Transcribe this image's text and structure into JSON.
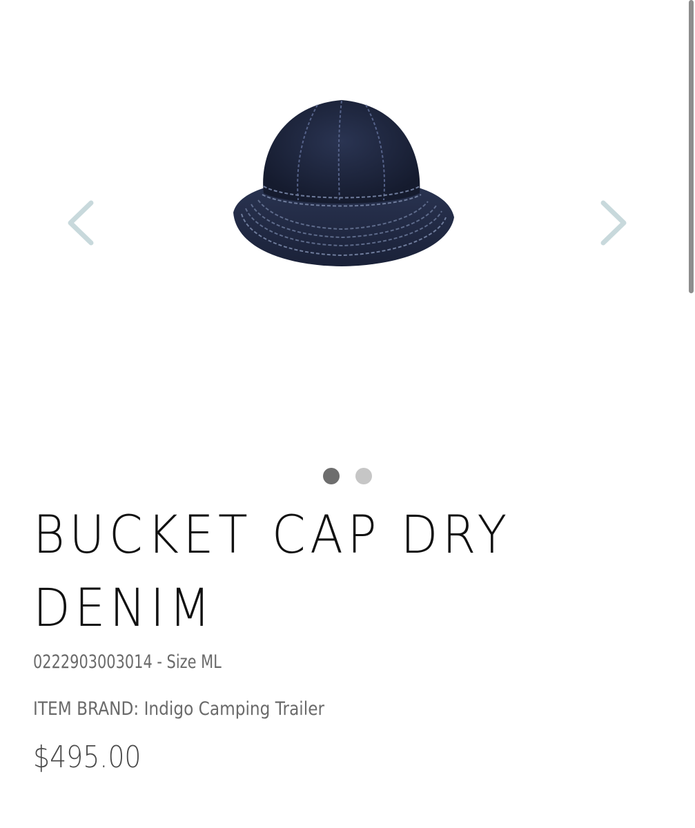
{
  "gallery": {
    "prev_icon": "chevron-left-icon",
    "next_icon": "chevron-right-icon",
    "arrow_color": "#c8d9dc",
    "image_subject": "denim bucket hat",
    "slides_total": 2,
    "active_slide": 1
  },
  "product": {
    "title_line1": "BUCKET CAP DRY",
    "title_line2": "DENIM",
    "sku_line": "0222903003014 - Size ML",
    "brand_line": "ITEM BRAND: Indigo Camping Trailer",
    "price": "$495.00"
  },
  "colors": {
    "title": "#111111",
    "meta_text": "#6a6a6a",
    "dot_active": "#6e6e6e",
    "dot_inactive": "#c6c6c6",
    "denim": "#1f2840"
  }
}
